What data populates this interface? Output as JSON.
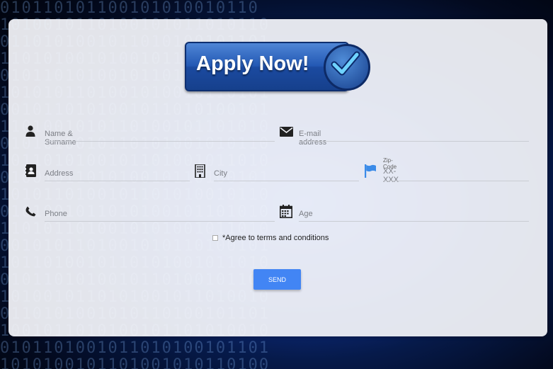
{
  "logo": {
    "text": "Apply Now!"
  },
  "form": {
    "name_placeholder": "Name & Surname",
    "email_placeholder": "E-mail address",
    "address_placeholder": "Address",
    "city_placeholder": "City",
    "zip_label": "Zip-Code",
    "zip_placeholder": "XX-XXX",
    "phone_placeholder": "Phone",
    "age_placeholder": "Age",
    "terms_label": "*Agree to terms and conditions",
    "send_label": "SEND"
  },
  "icons": {
    "name": "person-icon",
    "email": "envelope-icon",
    "address": "contact-card-icon",
    "city": "building-icon",
    "zip": "flag-icon",
    "phone": "phone-icon",
    "age": "calendar-icon"
  },
  "colors": {
    "accent": "#4285f4",
    "flag": "#3b8be8",
    "logo_blue": "#2459b4"
  }
}
